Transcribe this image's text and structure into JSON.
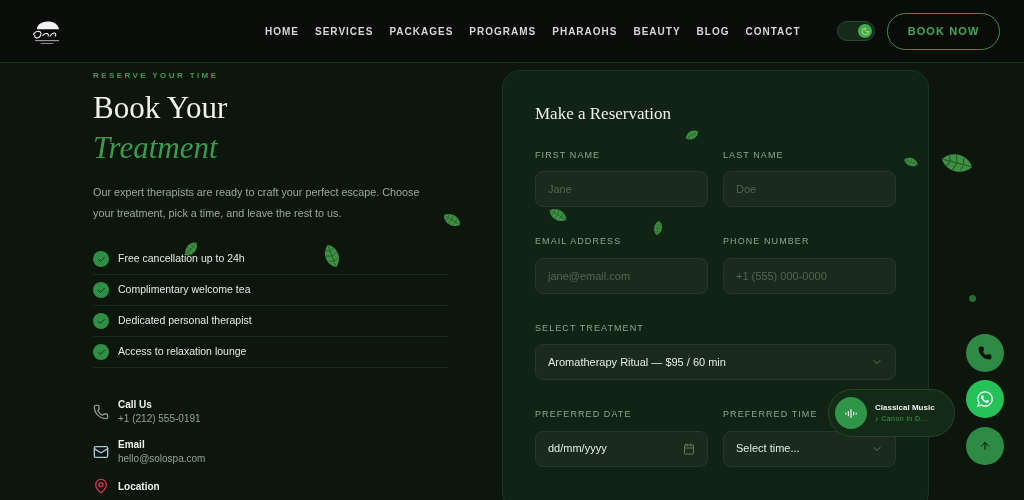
{
  "nav": {
    "links": [
      {
        "label": "HOME"
      },
      {
        "label": "SERVICES"
      },
      {
        "label": "PACKAGES"
      },
      {
        "label": "PROGRAMS"
      },
      {
        "label": "PHARAOHS"
      },
      {
        "label": "BEAUTY"
      },
      {
        "label": "BLOG"
      },
      {
        "label": "CONTACT"
      }
    ],
    "theme_toggle": {
      "on": true
    },
    "cta": "BOOK NOW"
  },
  "intro": {
    "eyebrow": "RESERVE YOUR TIME",
    "title": "Book Your",
    "title_accent": "Treatment",
    "text": "Our expert therapists are ready to craft your perfect escape. Choose your treatment, pick a time, and leave the rest to us.",
    "perks": [
      {
        "label": "Free cancellation up to 24h"
      },
      {
        "label": "Complimentary welcome tea"
      },
      {
        "label": "Dedicated personal therapist"
      },
      {
        "label": "Access to relaxation lounge"
      }
    ],
    "contacts": [
      {
        "kind": "phone",
        "title": "Call Us",
        "value": "+1 (212) 555-0191"
      },
      {
        "kind": "email",
        "title": "Email",
        "value": "hello@solospa.com"
      },
      {
        "kind": "location",
        "title": "Location"
      }
    ]
  },
  "form": {
    "title": "Make a Reservation",
    "rows": [
      [
        {
          "kind": "input",
          "label": "FIRST NAME",
          "placeholder": "Jane"
        },
        {
          "kind": "input",
          "label": "LAST NAME",
          "placeholder": "Doe"
        }
      ],
      [
        {
          "kind": "input",
          "label": "EMAIL ADDRESS",
          "placeholder": "jane@email.com"
        },
        {
          "kind": "input",
          "label": "PHONE NUMBER",
          "placeholder": "+1 (555) 000-0000"
        }
      ],
      [
        {
          "kind": "select",
          "label": "SELECT TREATMENT",
          "value": "Aromatherapy Ritual — $95 / 60 min"
        }
      ],
      [
        {
          "kind": "date",
          "label": "PREFERRED DATE",
          "value": "dd/mm/yyyy"
        },
        {
          "kind": "select",
          "label": "PREFERRED TIME",
          "value": "Select time..."
        }
      ]
    ]
  },
  "music": {
    "title": "Classical Music",
    "track": "♪ Canon in D..."
  }
}
